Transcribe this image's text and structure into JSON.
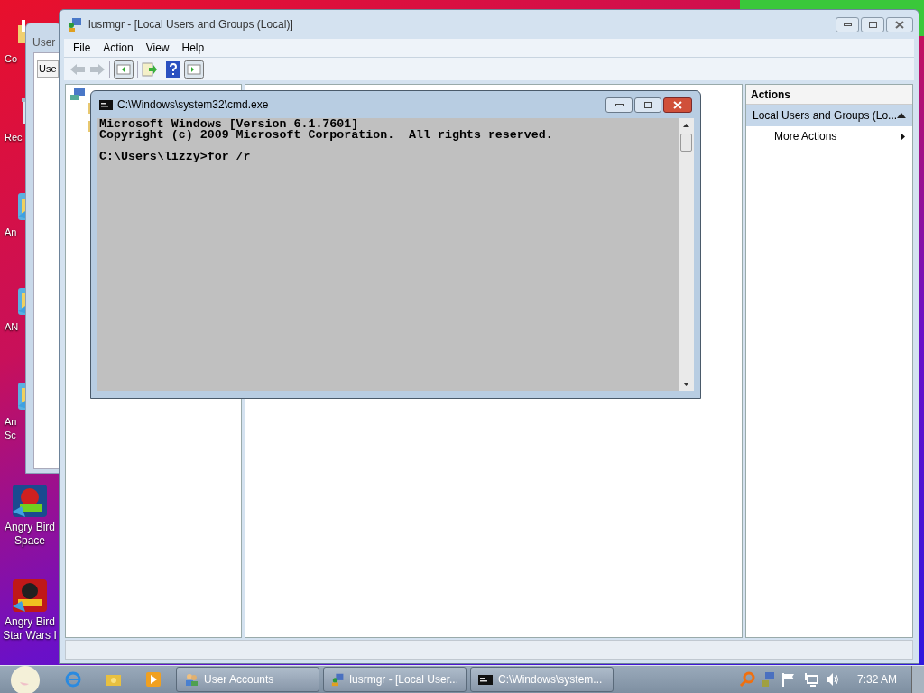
{
  "desktop_icons": [
    {
      "lines": [
        "Co"
      ],
      "kind": "folder"
    },
    {
      "lines": [
        "Rec"
      ],
      "kind": "bin"
    },
    {
      "lines": [
        "An"
      ],
      "kind": "game"
    },
    {
      "lines": [
        "AN"
      ],
      "kind": "game"
    },
    {
      "lines": [
        "An",
        "Sc"
      ],
      "kind": "game"
    },
    {
      "lines": [
        "Angry Bird",
        "Space"
      ],
      "kind": "space"
    },
    {
      "lines": [
        "Angry Bird",
        "Star Wars I"
      ],
      "kind": "starwars"
    }
  ],
  "back_window": {
    "title": "User",
    "tab": "Use"
  },
  "main_window": {
    "title": "lusrmgr - [Local Users and Groups (Local)]",
    "menu": [
      "File",
      "Action",
      "View",
      "Help"
    ],
    "actions_pane": {
      "header": "Actions",
      "section": "Local Users and Groups (Lo...",
      "items": [
        "More Actions"
      ]
    }
  },
  "console_window": {
    "title": "C:\\Windows\\system32\\cmd.exe",
    "header": [
      "Microsoft Windows [Version 6.1.7601]",
      "Copyright (c) 2009 Microsoft Corporation.  All rights reserved."
    ],
    "prompt": "C:\\Users\\lizzy>for /r"
  },
  "taskbar": {
    "buttons": [
      {
        "label": "User Accounts",
        "kind": "users"
      },
      {
        "label": "lusrmgr - [Local User...",
        "kind": "mmc"
      },
      {
        "label": "C:\\Windows\\system...",
        "kind": "cmd"
      }
    ],
    "clock": "7:32 AM"
  }
}
